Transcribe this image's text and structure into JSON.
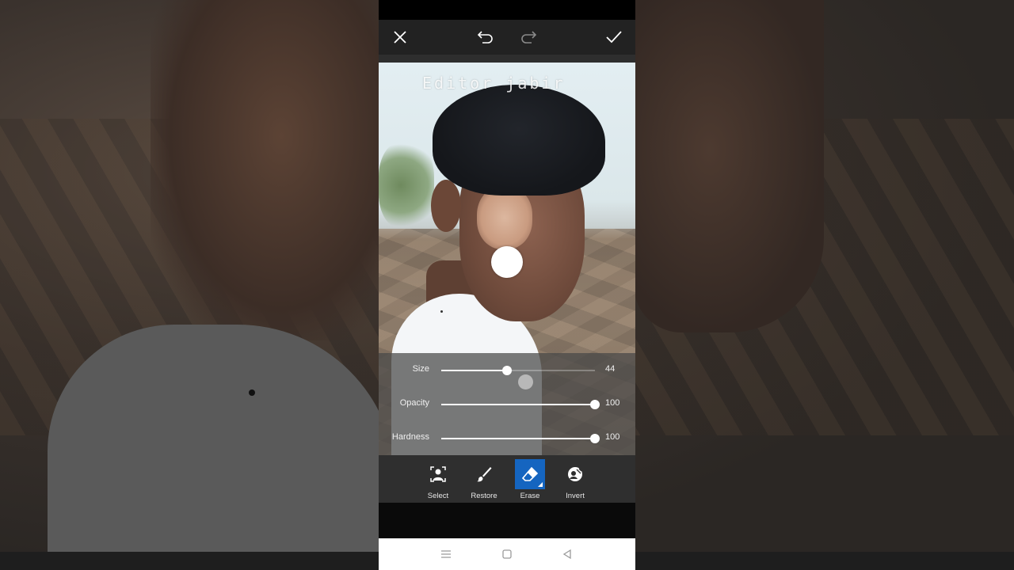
{
  "watermark": "Editor jabir",
  "topbar": {
    "close_icon": "close-icon",
    "undo_icon": "undo-icon",
    "redo_icon": "redo-icon",
    "apply_icon": "check-icon"
  },
  "sliders": [
    {
      "label": "Size",
      "value": "44",
      "fraction": 0.43
    },
    {
      "label": "Opacity",
      "value": "100",
      "fraction": 1.0
    },
    {
      "label": "Hardness",
      "value": "100",
      "fraction": 1.0
    }
  ],
  "tools": [
    {
      "label": "Select",
      "icon": "person-select-icon",
      "active": false
    },
    {
      "label": "Restore",
      "icon": "brush-icon",
      "active": false
    },
    {
      "label": "Erase",
      "icon": "eraser-icon",
      "active": true
    },
    {
      "label": "Invert",
      "icon": "invert-icon",
      "active": false
    }
  ],
  "navbar": {
    "menu_icon": "menu-icon",
    "home_icon": "home-square-icon",
    "back_icon": "back-triangle-icon"
  },
  "colors": {
    "accent": "#1565c0",
    "toolbar_bg": "#2f2f2f",
    "topbar_bg": "#222222"
  }
}
